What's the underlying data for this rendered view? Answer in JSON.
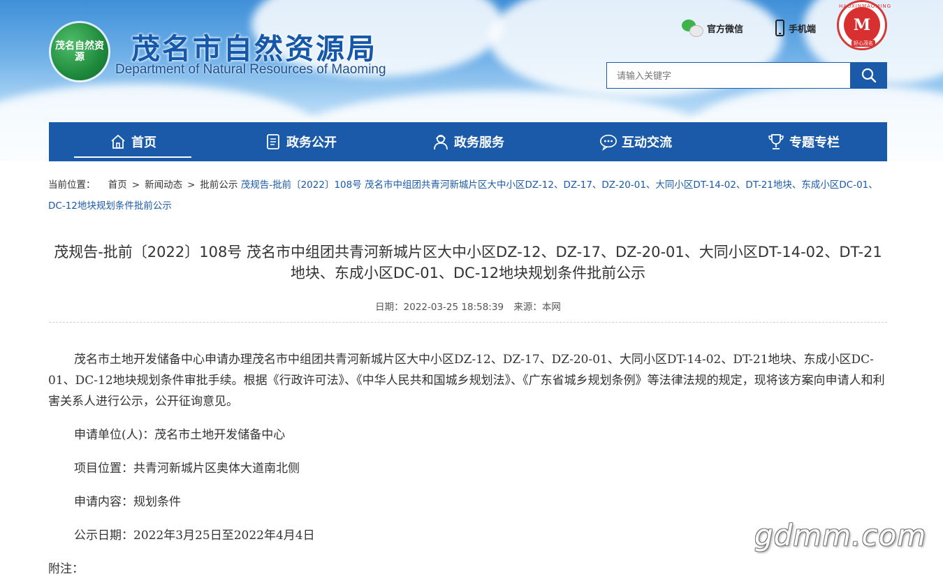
{
  "header": {
    "logo_text": "茂名自然资源",
    "title": "茂名市自然资源局",
    "subtitle": "Department of Natural Resources of Maoming",
    "links": [
      {
        "label": "官方微信",
        "icon": "wechat-icon"
      },
      {
        "label": "手机端",
        "icon": "mobile-phone-icon"
      }
    ],
    "emblem_ring": "HAOXINMAOMING",
    "emblem_bottom": "好心茂名",
    "search": {
      "placeholder": "请输入关键字",
      "icon": "search-icon"
    }
  },
  "nav": {
    "items": [
      {
        "label": "首页",
        "icon": "home-icon",
        "active": true
      },
      {
        "label": "政务公开",
        "icon": "document-icon"
      },
      {
        "label": "政务服务",
        "icon": "service-person-icon"
      },
      {
        "label": "互动交流",
        "icon": "chat-bubble-icon"
      },
      {
        "label": "专题专栏",
        "icon": "trophy-icon"
      }
    ]
  },
  "breadcrumb": {
    "label": "当前位置：",
    "items": [
      "首页",
      "新闻动态",
      "批前公示"
    ],
    "current": "茂规告-批前〔2022〕108号 茂名市中组团共青河新城片区大中小区DZ-12、DZ-17、DZ-20-01、大同小区DT-14-02、DT-21地块、东成小区DC-01、DC-12地块规划条件批前公示"
  },
  "article": {
    "title": "茂规告-批前〔2022〕108号 茂名市中组团共青河新城片区大中小区DZ-12、DZ-17、DZ-20-01、大同小区DT-14-02、DT-21地块、东成小区DC-01、DC-12地块规划条件批前公示",
    "date_label": "日期：",
    "date": "2022-03-25 18:58:39",
    "source_label": "来源：",
    "source": "本网",
    "intro": "茂名市土地开发储备中心申请办理茂名市中组团共青河新城片区大中小区DZ-12、DZ-17、DZ-20-01、大同小区DT-14-02、DT-21地块、东成小区DC-01、DC-12地块规划条件审批手续。根据《行政许可法》、《中华人民共和国城乡规划法》、《广东省城乡规划条例》等法律法规的规定，现将该方案向申请人和利害关系人进行公示，公开征询意见。",
    "applicant": "申请单位(人)：茂名市土地开发储备中心",
    "location": "项目位置：共青河新城片区奥体大道南北侧",
    "content": "申请内容：规划条件",
    "period": "公示日期：2022年3月25日至2022年4月4日",
    "note": "附注："
  },
  "watermark": "gdmm.com"
}
